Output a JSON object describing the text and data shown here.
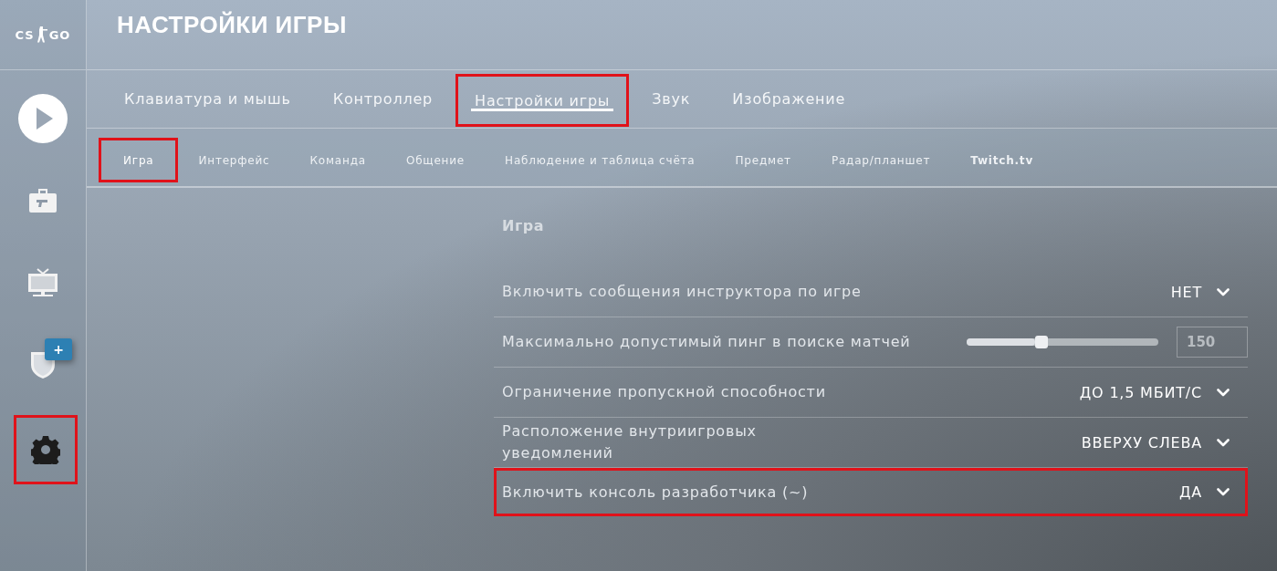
{
  "logo": {
    "left": "CS",
    "right": "GO"
  },
  "sidebar": {
    "items": [
      {
        "kind": "play",
        "selected": false,
        "highlighted": false
      },
      {
        "kind": "briefcase",
        "selected": false,
        "highlighted": false
      },
      {
        "kind": "tv",
        "selected": false,
        "highlighted": false
      },
      {
        "kind": "shield",
        "selected": false,
        "highlighted": false,
        "badge": "+"
      },
      {
        "kind": "settings",
        "selected": true,
        "highlighted": true
      }
    ]
  },
  "title": "НАСТРОЙКИ ИГРЫ",
  "tabs": [
    {
      "label": "Клавиатура и мышь",
      "selected": false,
      "highlighted": false
    },
    {
      "label": "Контроллер",
      "selected": false,
      "highlighted": false
    },
    {
      "label": "Настройки игры",
      "selected": true,
      "highlighted": true
    },
    {
      "label": "Звук",
      "selected": false,
      "highlighted": false
    },
    {
      "label": "Изображение",
      "selected": false,
      "highlighted": false
    }
  ],
  "subtabs": [
    {
      "label": "Игра",
      "selected": true,
      "highlighted": true,
      "emphasized": false
    },
    {
      "label": "Интерфейс",
      "selected": false,
      "highlighted": false,
      "emphasized": false
    },
    {
      "label": "Команда",
      "selected": false,
      "highlighted": false,
      "emphasized": false
    },
    {
      "label": "Общение",
      "selected": false,
      "highlighted": false,
      "emphasized": false
    },
    {
      "label": "Наблюдение и таблица счёта",
      "selected": false,
      "highlighted": false,
      "emphasized": false
    },
    {
      "label": "Предмет",
      "selected": false,
      "highlighted": false,
      "emphasized": false
    },
    {
      "label": "Радар/планшет",
      "selected": false,
      "highlighted": false,
      "emphasized": false
    },
    {
      "label": "Twitch.tv",
      "selected": false,
      "highlighted": false,
      "emphasized": true
    }
  ],
  "section_title": "Игра",
  "settings": [
    {
      "kind": "dropdown",
      "label": "Включить сообщения инструктора по игре",
      "value": "НЕТ",
      "highlighted": false
    },
    {
      "kind": "slider",
      "label": "Максимально допустимый пинг в поиске матчей",
      "level": 0.39,
      "value": "150",
      "highlighted": false
    },
    {
      "kind": "dropdown",
      "label": "Ограничение пропускной способности",
      "value": "ДО 1,5 МБИТ/С",
      "highlighted": false
    },
    {
      "kind": "dropdown",
      "label": "Расположение внутриигровых\nуведомлений",
      "value": "ВВЕРХУ СЛЕВА",
      "highlighted": false
    },
    {
      "kind": "dropdown",
      "label": "Включить консоль разработчика (~)",
      "value": "ДА",
      "highlighted": true
    }
  ]
}
